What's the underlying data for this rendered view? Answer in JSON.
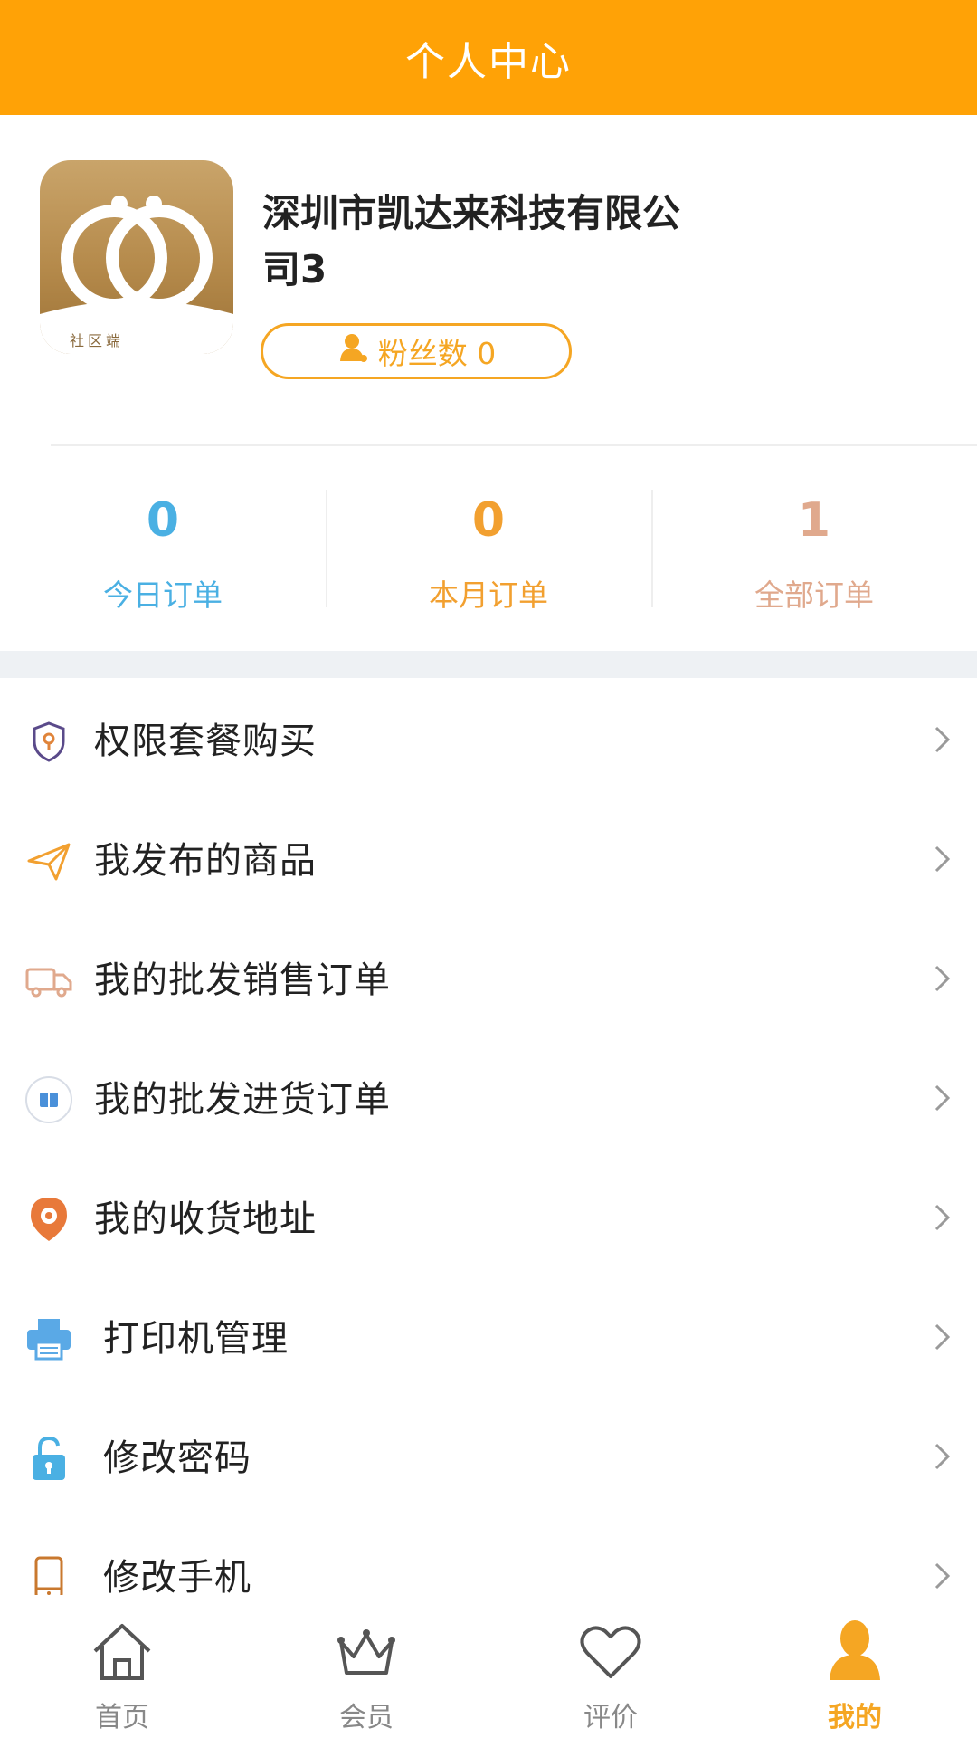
{
  "header": {
    "title": "个人中心"
  },
  "profile": {
    "company_name": "深圳市凯达来科技有限公司3",
    "logo_caption": "社区端",
    "fans_label": "粉丝数 0"
  },
  "stats": [
    {
      "value": "0",
      "label": "今日订单",
      "color": "#4AB0E3"
    },
    {
      "value": "0",
      "label": "本月订单",
      "color": "#F2A030"
    },
    {
      "value": "1",
      "label": "全部订单",
      "color": "#E0A98D"
    }
  ],
  "menu": [
    {
      "label": "权限套餐购买",
      "icon": "shield-icon"
    },
    {
      "label": "我发布的商品",
      "icon": "paper-plane-icon"
    },
    {
      "label": "我的批发销售订单",
      "icon": "truck-icon"
    },
    {
      "label": "我的批发进货订单",
      "icon": "book-icon"
    },
    {
      "label": "我的收货地址",
      "icon": "location-pin-icon"
    },
    {
      "label": "打印机管理",
      "icon": "printer-icon"
    },
    {
      "label": "修改密码",
      "icon": "lock-icon"
    },
    {
      "label": "修改手机",
      "icon": "phone-icon"
    }
  ],
  "tabbar": [
    {
      "label": "首页",
      "icon": "home-icon"
    },
    {
      "label": "会员",
      "icon": "crown-icon"
    },
    {
      "label": "评价",
      "icon": "heart-icon"
    },
    {
      "label": "我的",
      "icon": "user-icon",
      "active": true
    }
  ],
  "colors": {
    "brand": "#FFA206",
    "accent": "#F5A623",
    "page_band": "#EEF1F4"
  }
}
